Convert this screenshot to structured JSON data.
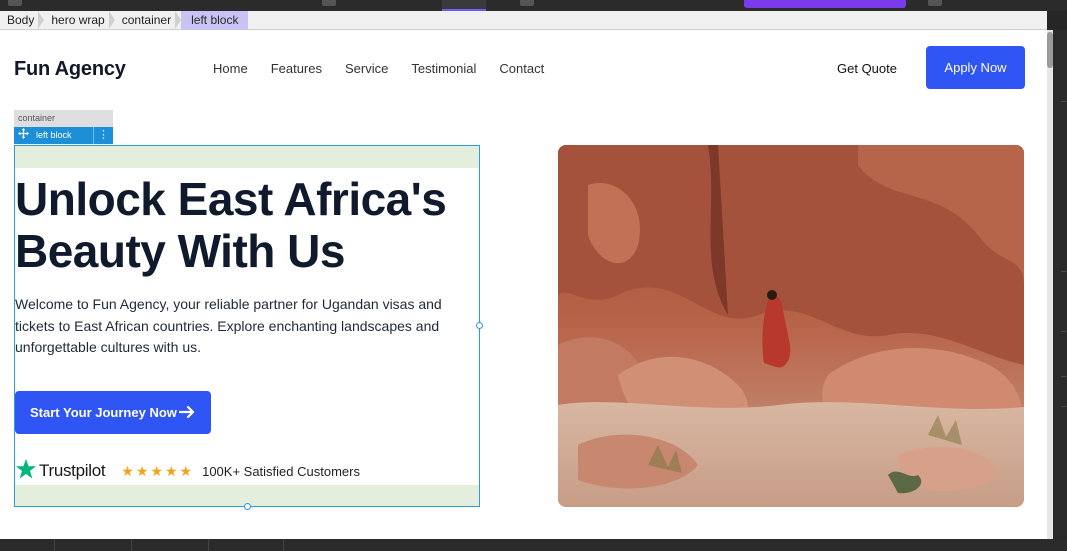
{
  "breadcrumb": {
    "items": [
      "Body",
      "hero wrap",
      "container",
      "left block"
    ]
  },
  "nav": {
    "logo": "Fun Agency",
    "links": [
      "Home",
      "Features",
      "Service",
      "Testimonial",
      "Contact"
    ],
    "get_quote": "Get Quote",
    "apply": "Apply Now"
  },
  "selection": {
    "container_tag": "container",
    "left_block_tag": "left block"
  },
  "hero": {
    "title_line1": "Unlock East Africa's",
    "title_line2": "Beauty With Us",
    "description": "Welcome to Fun Agency, your reliable partner for Ugandan visas and tickets to East African countries. Explore enchanting landscapes and unforgettable cultures with us.",
    "cta": "Start Your Journey Now",
    "trust_brand": "Trustpilot",
    "rating_stars": 5,
    "satisfied": "100K+ Satisfied Customers"
  },
  "colors": {
    "primary": "#2f55f4",
    "dark_text": "#0f1b2d",
    "selection_blue": "#2d9cdb",
    "trustpilot_green": "#00b67a",
    "star_orange": "#f4a21c",
    "breadcrumb_active": "#c9c3f3"
  },
  "icons": {
    "move": "move-icon",
    "more": "more-vertical-icon",
    "arrow": "arrow-right-icon",
    "trust_star": "trustpilot-star-icon",
    "rating_star": "star-icon"
  }
}
